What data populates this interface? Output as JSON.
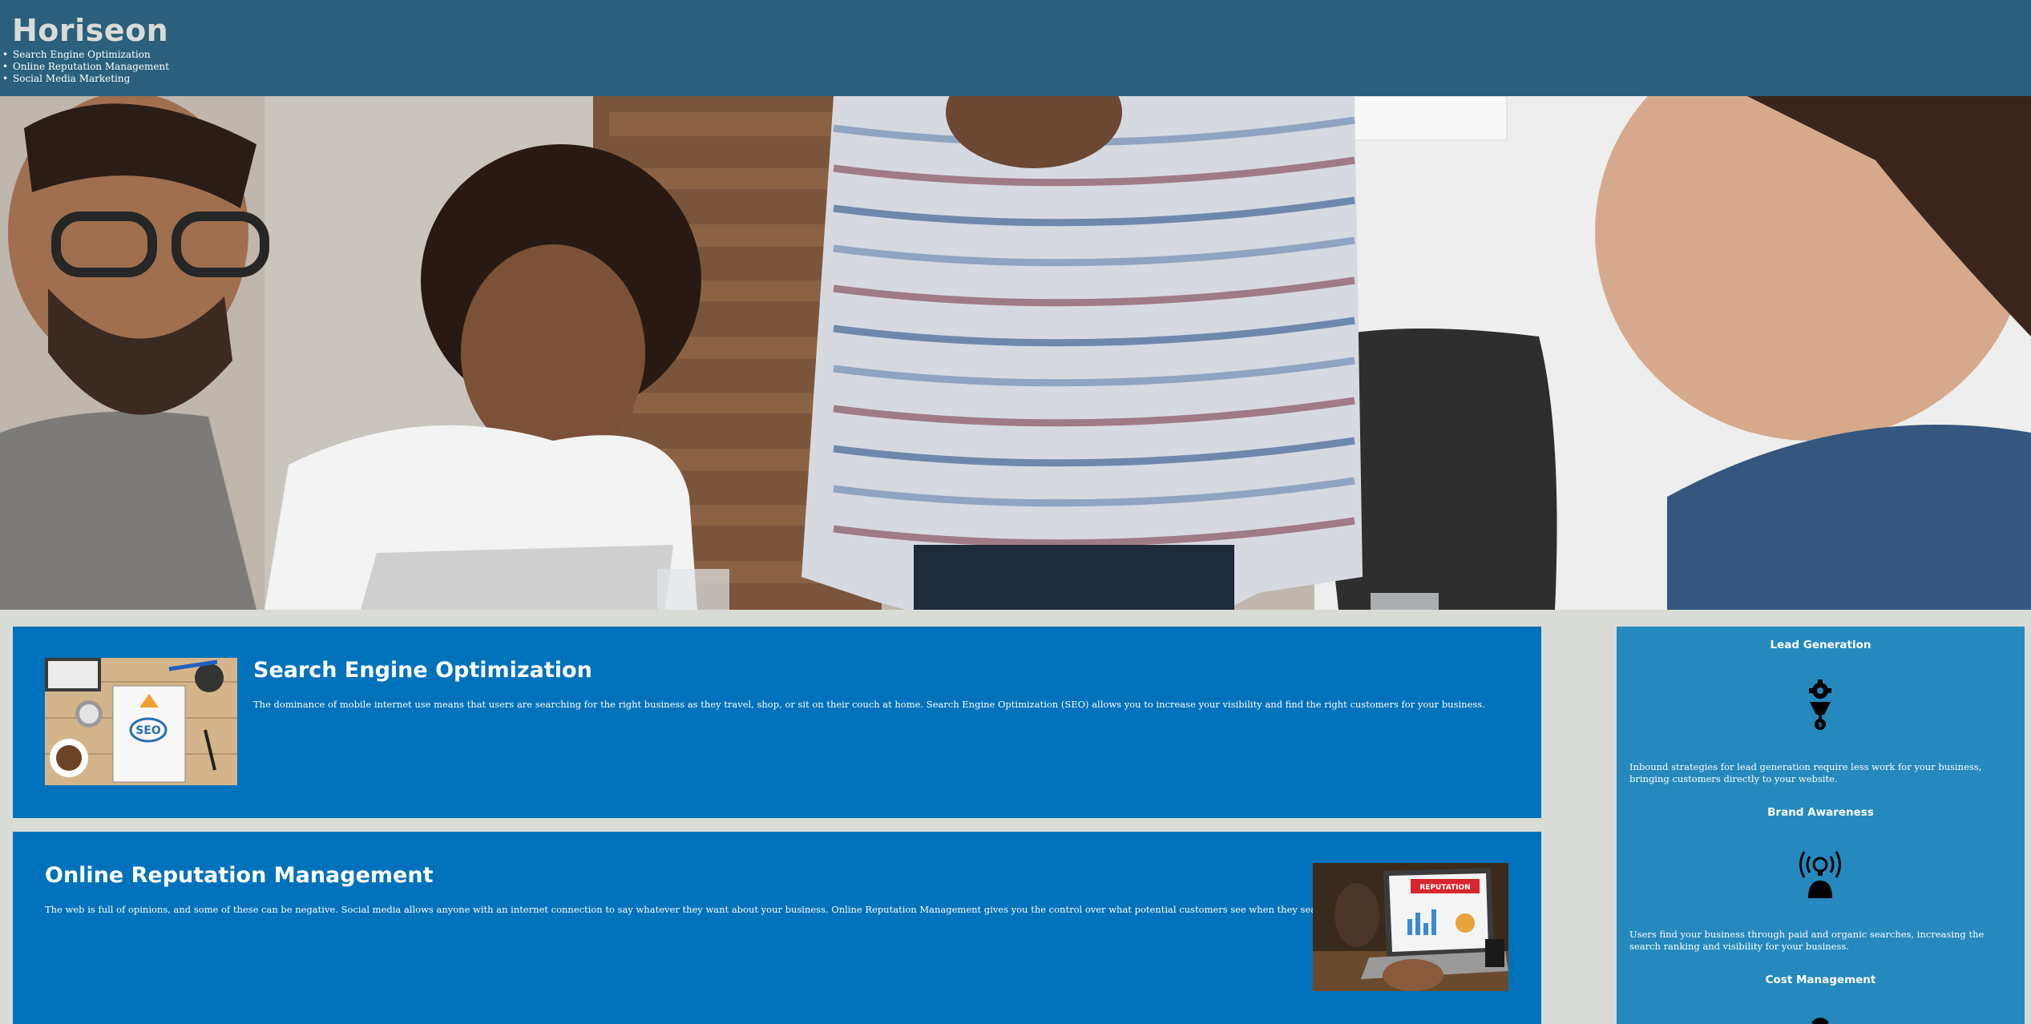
{
  "header": {
    "logo": "Horiseon",
    "nav": [
      {
        "label": "Search Engine Optimization"
      },
      {
        "label": "Online Reputation Management"
      },
      {
        "label": "Social Media Marketing"
      }
    ]
  },
  "hero": {
    "image": "team-meeting-photo"
  },
  "content": {
    "seo": {
      "title": "Search Engine Optimization",
      "text": "The dominance of mobile internet use means that users are searching for the right business as they travel, shop, or sit on their couch at home. Search Engine Optimization (SEO) allows you to increase your visibility and find the right customers for your business.",
      "image": "seo-notebook-photo",
      "image_text": "SEO"
    },
    "orm": {
      "title": "Online Reputation Management",
      "text": "The web is full of opinions, and some of these can be negative. Social media allows anyone with an internet connection to say whatever they want about your business. Online Reputation Management gives you the control over what potential customers see when they search for your business.",
      "image": "reputation-laptop-photo",
      "image_text": "REPUTATION"
    }
  },
  "aside": {
    "benefits": [
      {
        "title": "Lead Generation",
        "icon": "lead-generation-icon",
        "text": "Inbound strategies for lead generation require less work for your business, bringing customers directly to your website."
      },
      {
        "title": "Brand Awareness",
        "icon": "brand-awareness-icon",
        "text": "Users find your business through paid and organic searches, increasing the search ranking and visibility for your business."
      },
      {
        "title": "Cost Management",
        "icon": "cost-management-icon",
        "text": ""
      }
    ]
  },
  "colors": {
    "header_bg": "#2a607c",
    "page_bg": "#d9dcd6",
    "content_bg": "#0072bb",
    "aside_bg": "#2589bd",
    "logo_color": "#d9dcd6"
  }
}
